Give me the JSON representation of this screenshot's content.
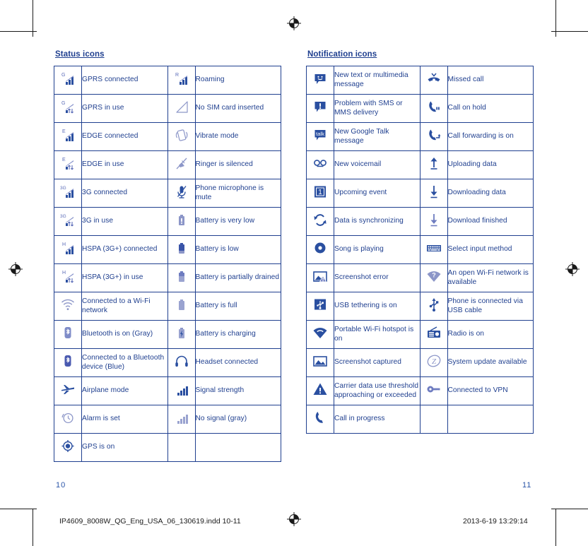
{
  "colors": {
    "ink_blue": "#1f3f8f",
    "icon_blue": "#2a4fa0",
    "icon_gray_blue": "#8c96c8",
    "page_number_blue": "#2a55a8",
    "crop_mark": "#1a1a1a"
  },
  "left_section": {
    "title": "Status icons",
    "rows": [
      {
        "icon_a": "gprs-connected-icon",
        "label_a": "GPRS connected",
        "icon_b": "roaming-icon",
        "label_b": "Roaming"
      },
      {
        "icon_a": "gprs-in-use-icon",
        "label_a": "GPRS in use",
        "icon_b": "no-sim-card-icon",
        "label_b": "No SIM card inserted"
      },
      {
        "icon_a": "edge-connected-icon",
        "label_a": "EDGE connected",
        "icon_b": "vibrate-mode-icon",
        "label_b": "Vibrate mode"
      },
      {
        "icon_a": "edge-in-use-icon",
        "label_a": "EDGE in use",
        "icon_b": "ringer-silenced-icon",
        "label_b": "Ringer is silenced"
      },
      {
        "icon_a": "3g-connected-icon",
        "label_a": "3G connected",
        "icon_b": "microphone-mute-icon",
        "label_b": "Phone microphone is mute"
      },
      {
        "icon_a": "3g-in-use-icon",
        "label_a": "3G in use",
        "icon_b": "battery-very-low-icon",
        "label_b": "Battery is very low"
      },
      {
        "icon_a": "hspa-connected-icon",
        "label_a": "HSPA (3G+) connected",
        "icon_b": "battery-low-icon",
        "label_b": "Battery is low"
      },
      {
        "icon_a": "hspa-in-use-icon",
        "label_a": "HSPA (3G+) in use",
        "icon_b": "battery-partially-drained-icon",
        "label_b": "Battery is partially drained"
      },
      {
        "icon_a": "wifi-connected-icon",
        "label_a": "Connected to a Wi-Fi network",
        "icon_b": "battery-full-icon",
        "label_b": "Battery is full"
      },
      {
        "icon_a": "bluetooth-on-gray-icon",
        "label_a": "Bluetooth is on (Gray)",
        "icon_b": "battery-charging-icon",
        "label_b": "Battery is charging"
      },
      {
        "icon_a": "bluetooth-connected-blue-icon",
        "label_a": "Connected to a Bluetooth device (Blue)",
        "icon_b": "headset-connected-icon",
        "label_b": "Headset connected"
      },
      {
        "icon_a": "airplane-mode-icon",
        "label_a": "Airplane mode",
        "icon_b": "signal-strength-icon",
        "label_b": "Signal strength"
      },
      {
        "icon_a": "alarm-set-icon",
        "label_a": "Alarm is set",
        "icon_b": "no-signal-gray-icon",
        "label_b": "No signal (gray)"
      },
      {
        "icon_a": "gps-on-icon",
        "label_a": "GPS is on",
        "icon_b": "",
        "label_b": ""
      }
    ]
  },
  "right_section": {
    "title": "Notification icons",
    "rows": [
      {
        "icon_a": "new-message-icon",
        "label_a": "New text or multimedia message",
        "icon_b": "missed-call-icon",
        "label_b": "Missed call"
      },
      {
        "icon_a": "message-problem-icon",
        "label_a": "Problem with SMS or MMS delivery",
        "icon_b": "call-on-hold-icon",
        "label_b": "Call on hold"
      },
      {
        "icon_a": "google-talk-message-icon",
        "label_a": "New Google Talk message",
        "icon_b": "call-forwarding-icon",
        "label_b": "Call forwarding is on"
      },
      {
        "icon_a": "new-voicemail-icon",
        "label_a": "New voicemail",
        "icon_b": "uploading-data-icon",
        "label_b": "Uploading data"
      },
      {
        "icon_a": "upcoming-event-icon",
        "label_a": "Upcoming event",
        "icon_b": "downloading-data-icon",
        "label_b": "Downloading data"
      },
      {
        "icon_a": "data-synchronizing-icon",
        "label_a": "Data is synchronizing",
        "icon_b": "download-finished-icon",
        "label_b": "Download finished"
      },
      {
        "icon_a": "song-playing-icon",
        "label_a": "Song is playing",
        "icon_b": "select-input-method-icon",
        "label_b": "Select input method"
      },
      {
        "icon_a": "screenshot-error-icon",
        "label_a": "Screenshot error",
        "icon_b": "open-wifi-available-icon",
        "label_b": "An open Wi-Fi network is available"
      },
      {
        "icon_a": "usb-tethering-icon",
        "label_a": "USB tethering is on",
        "icon_b": "usb-connected-icon",
        "label_b": "Phone is connected via USB cable"
      },
      {
        "icon_a": "portable-hotspot-icon",
        "label_a": "Portable Wi-Fi hotspot is on",
        "icon_b": "radio-on-icon",
        "label_b": "Radio is on"
      },
      {
        "icon_a": "screenshot-captured-icon",
        "label_a": "Screenshot captured",
        "icon_b": "system-update-icon",
        "label_b": "System update available"
      },
      {
        "icon_a": "data-threshold-warning-icon",
        "label_a": "Carrier data use threshold approaching or exceeded",
        "icon_b": "vpn-connected-icon",
        "label_b": "Connected to VPN"
      },
      {
        "icon_a": "call-in-progress-icon",
        "label_a": "Call in progress",
        "icon_b": "",
        "label_b": ""
      }
    ]
  },
  "footer": {
    "page_left": "10",
    "page_right": "11",
    "file_name": "IP4609_8008W_QG_Eng_USA_06_130619.indd   10-11",
    "timestamp": "2013-6-19   13:29:14"
  }
}
